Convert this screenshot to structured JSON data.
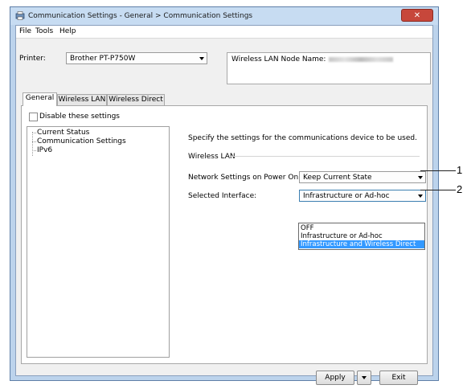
{
  "window": {
    "title": "Communication Settings - General > Communication Settings",
    "close_label": "✕"
  },
  "menu": {
    "file": "File",
    "tools": "Tools",
    "help": "Help"
  },
  "printer": {
    "label": "Printer:",
    "value": "Brother PT-P750W"
  },
  "node_name": {
    "label": "Wireless LAN Node Name:"
  },
  "tabs": [
    {
      "label": "General"
    },
    {
      "label": "Wireless LAN"
    },
    {
      "label": "Wireless Direct"
    }
  ],
  "disable_checkbox": {
    "label": "Disable these settings",
    "checked": false
  },
  "tree": {
    "items": [
      {
        "label": "Current Status"
      },
      {
        "label": "Communication Settings"
      },
      {
        "label": "IPv6"
      }
    ]
  },
  "panel": {
    "description": "Specify the settings for the communications device to be used.",
    "group_label": "Wireless LAN",
    "network_label": "Network Settings on Power On:",
    "network_value": "Keep Current State",
    "interface_label": "Selected Interface:",
    "interface_value": "Infrastructure or Ad-hoc",
    "interface_options": [
      {
        "label": "OFF"
      },
      {
        "label": "Infrastructure or Ad-hoc"
      },
      {
        "label": "Infrastructure and Wireless Direct"
      }
    ],
    "highlighted_option": "Infrastructure and Wireless Direct"
  },
  "callouts": [
    "1",
    "2"
  ],
  "buttons": {
    "apply": "Apply",
    "exit": "Exit"
  }
}
